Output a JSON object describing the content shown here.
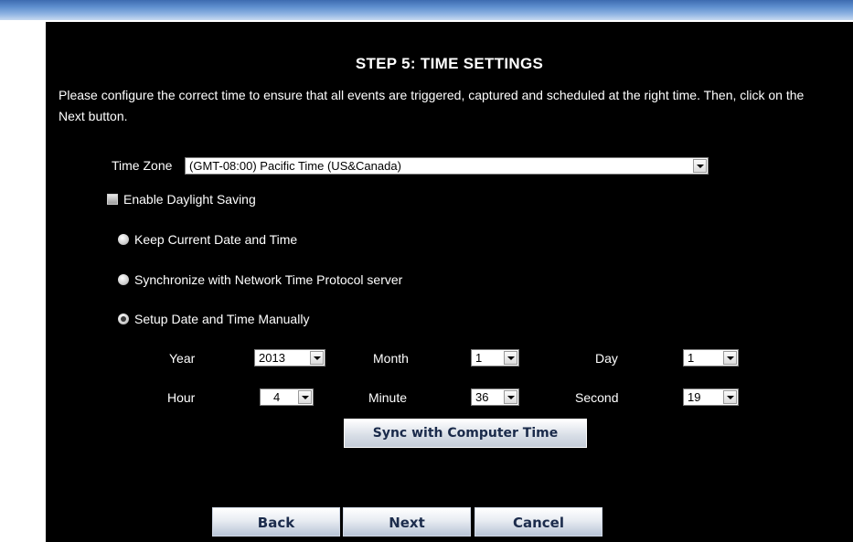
{
  "header": {
    "title": "STEP 5: TIME SETTINGS"
  },
  "description": "Please configure the correct time to ensure that all events are triggered, captured and scheduled at the right time. Then, click on the Next button.",
  "timezone": {
    "label": "Time Zone",
    "value": "(GMT-08:00) Pacific Time (US&Canada)"
  },
  "daylight": {
    "label": "Enable Daylight Saving",
    "checked": false
  },
  "options": {
    "keep_current": "Keep Current Date and Time",
    "ntp": "Synchronize with Network Time Protocol server",
    "manual": "Setup Date and Time Manually",
    "selected": "manual"
  },
  "datetime": {
    "year_label": "Year",
    "year": "2013",
    "month_label": "Month",
    "month": "1",
    "day_label": "Day",
    "day": "1",
    "hour_label": "Hour",
    "hour": "4",
    "minute_label": "Minute",
    "minute": "36",
    "second_label": "Second",
    "second": "19"
  },
  "sync_button": "Sync with Computer Time",
  "nav": {
    "back": "Back",
    "next": "Next",
    "cancel": "Cancel"
  },
  "colors": {
    "panel_bg": "#000000",
    "topbar": "#5f8fcf",
    "text": "#ffffff"
  }
}
